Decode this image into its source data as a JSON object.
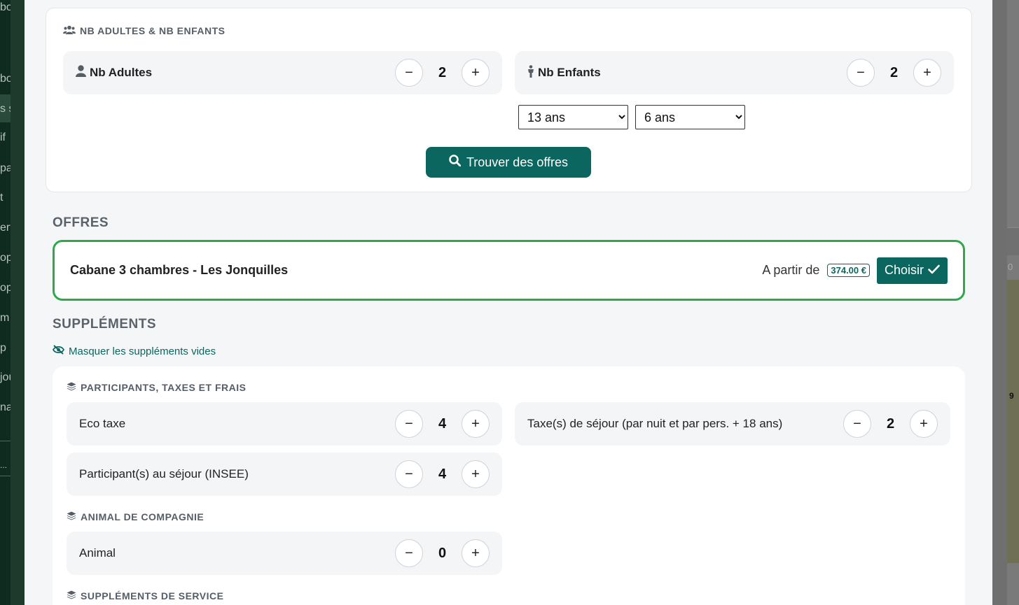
{
  "background_sidebar": {
    "items": [
      "bo",
      "s s",
      "if",
      "pa",
      "t",
      "erv",
      "op",
      "op",
      "m",
      "p",
      "jou",
      "na",
      "..."
    ]
  },
  "background_right": {
    "zero": "0",
    "number": "9"
  },
  "guests": {
    "section_title": "NB ADULTES & NB ENFANTS",
    "adults": {
      "label": "Nb Adultes",
      "count": "2"
    },
    "children": {
      "label": "Nb Enfants",
      "count": "2"
    },
    "child_ages": [
      {
        "selected": "13 ans"
      },
      {
        "selected": "6 ans"
      }
    ],
    "find_button": "Trouver des offres"
  },
  "offers": {
    "title": "OFFRES",
    "items": [
      {
        "name": "Cabane 3 chambres - Les Jonquilles",
        "from_label": "A partir de",
        "price": "374.00 €",
        "choose_label": "Choisir"
      }
    ]
  },
  "supplements": {
    "title": "SUPPLÉMENTS",
    "hide_empty_label": "Masquer les suppléments vides",
    "groups": [
      {
        "title": "PARTICIPANTS, TAXES ET FRAIS",
        "items": [
          {
            "label": "Eco taxe",
            "count": "4"
          },
          {
            "label": "Taxe(s) de séjour (par nuit et par pers. + 18 ans)",
            "count": "2"
          },
          {
            "label": "Participant(s) au séjour (INSEE)",
            "count": "4"
          }
        ]
      },
      {
        "title": "ANIMAL DE COMPAGNIE",
        "items": [
          {
            "label": "Animal",
            "count": "0"
          }
        ]
      },
      {
        "title": "SUPPLÉMENTS DE SERVICE",
        "items": []
      }
    ]
  },
  "colors": {
    "primary": "#0b6660",
    "offer_border": "#2ea84a"
  }
}
